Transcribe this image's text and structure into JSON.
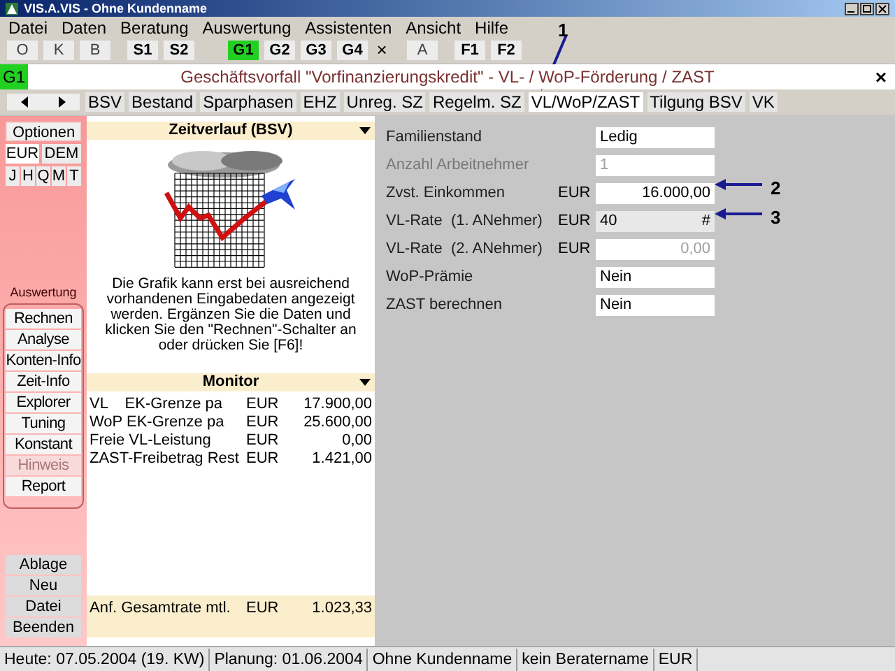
{
  "window": {
    "title": "VIS.A.VIS - Ohne Kundenname"
  },
  "menu": [
    "Datei",
    "Daten",
    "Beratung",
    "Auswertung",
    "Assistenten",
    "Ansicht",
    "Hilfe"
  ],
  "toolbar": [
    {
      "label": "O",
      "kind": "plain",
      "selected": false
    },
    {
      "label": "K",
      "kind": "plain",
      "selected": false
    },
    {
      "label": "B",
      "kind": "plain",
      "selected": false
    },
    {
      "label": "S1",
      "kind": "bold",
      "selected": false
    },
    {
      "label": "S2",
      "kind": "bold",
      "selected": false
    },
    {
      "label": "G1",
      "kind": "bold",
      "selected": true
    },
    {
      "label": "G2",
      "kind": "bold",
      "selected": false
    },
    {
      "label": "G3",
      "kind": "bold",
      "selected": false
    },
    {
      "label": "G4",
      "kind": "bold",
      "selected": false
    },
    {
      "label": "×",
      "kind": "glyph"
    },
    {
      "label": "A",
      "kind": "plain",
      "selected": false
    },
    {
      "label": "F1",
      "kind": "bold",
      "selected": false
    },
    {
      "label": "F2",
      "kind": "bold",
      "selected": false
    }
  ],
  "case_bar": {
    "badge": "G1",
    "title": "Geschäftsvorfall \"Vorfinanzierungskredit\" - VL- / WoP-Förderung / ZAST",
    "close": "×"
  },
  "tabs": [
    {
      "label": "BSV",
      "selected": false
    },
    {
      "label": "Bestand",
      "selected": false
    },
    {
      "label": "Sparphasen",
      "selected": false
    },
    {
      "label": "EHZ",
      "selected": false
    },
    {
      "label": "Unreg. SZ",
      "selected": false
    },
    {
      "label": "Regelm. SZ",
      "selected": false
    },
    {
      "label": "VL/WoP/ZAST",
      "selected": true
    },
    {
      "label": "Tilgung BSV",
      "selected": false
    },
    {
      "label": "VK",
      "selected": false
    }
  ],
  "sidebar": {
    "options": "Optionen",
    "currencies": [
      {
        "label": "EUR",
        "selected": true
      },
      {
        "label": "DEM",
        "selected": false
      }
    ],
    "periods": [
      "J",
      "H",
      "Q",
      "M",
      "T"
    ],
    "group_label": "Auswertung",
    "group_buttons": [
      {
        "label": "Rechnen",
        "disabled": false
      },
      {
        "label": "Analyse",
        "disabled": false
      },
      {
        "label": "Konten-Info",
        "disabled": false
      },
      {
        "label": "Zeit-Info",
        "disabled": false
      },
      {
        "label": "Explorer",
        "disabled": false
      },
      {
        "label": "Tuning",
        "disabled": false
      },
      {
        "label": "Konstant",
        "disabled": false
      },
      {
        "label": "Hinweis",
        "disabled": true
      },
      {
        "label": "Report",
        "disabled": false
      }
    ],
    "bottom_buttons": [
      "Ablage",
      "Neu",
      "Datei",
      "Beenden"
    ]
  },
  "timeline": {
    "title": "Zeitverlauf (BSV)",
    "message": "Die Grafik kann erst bei ausreichend vorhandenen Eingabedaten angezeigt werden. Ergänzen Sie die Daten und klicken Sie den \"Rechnen\"-Schalter an oder drücken Sie [F6]!"
  },
  "monitor": {
    "title": "Monitor",
    "rows": [
      {
        "label": "VL    EK-Grenze pa",
        "currency": "EUR",
        "value": "17.900,00"
      },
      {
        "label": "WoP EK-Grenze pa",
        "currency": "EUR",
        "value": "25.600,00"
      },
      {
        "label": "Freie VL-Leistung",
        "currency": "EUR",
        "value": "0,00"
      },
      {
        "label": "ZAST-Freibetrag Rest",
        "currency": "EUR",
        "value": "1.421,00"
      }
    ],
    "total": {
      "label": "Anf. Gesamtrate mtl.",
      "currency": "EUR",
      "value": "1.023,33"
    }
  },
  "form": [
    {
      "label": "Familienstand",
      "value": "Ledig",
      "kind": "text",
      "disabled": false,
      "focused": false
    },
    {
      "label": "Anzahl Arbeitnehmer",
      "value": "1",
      "kind": "text",
      "disabled": true,
      "focused": false
    },
    {
      "label": "Zvst. Einkommen",
      "currency": "EUR",
      "value": "16.000,00",
      "kind": "amount",
      "disabled": false,
      "focused": false
    },
    {
      "label": "VL-Rate  (1. ANehmer)",
      "currency": "EUR",
      "value": "40",
      "suffix": "#",
      "kind": "text",
      "disabled": false,
      "focused": true
    },
    {
      "label": "VL-Rate  (2. ANehmer)",
      "currency": "EUR",
      "value": "0,00",
      "kind": "amount",
      "disabled": true,
      "focused": false
    },
    {
      "label": "WoP-Prämie",
      "value": "Nein",
      "kind": "text",
      "disabled": false,
      "focused": false
    },
    {
      "label": "ZAST berechnen",
      "value": "Nein",
      "kind": "text",
      "disabled": false,
      "focused": false
    }
  ],
  "callouts": [
    "1",
    "2",
    "3"
  ],
  "status_bar": [
    "Heute: 07.05.2004 (19. KW)",
    "Planung: 01.06.2004",
    "Ohne Kundenname",
    "kein Beratername",
    "EUR"
  ]
}
